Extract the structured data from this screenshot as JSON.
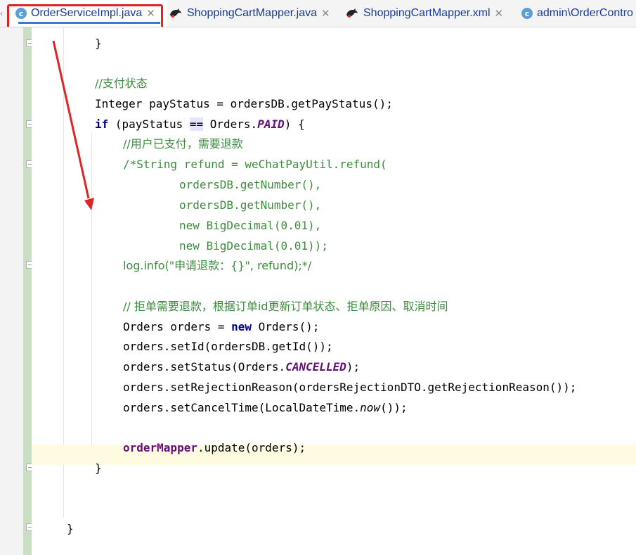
{
  "tabs": [
    {
      "label": "OrderServiceImpl.java",
      "icon": "java-class-icon",
      "active": true,
      "closable": true
    },
    {
      "label": "ShoppingCartMapper.java",
      "icon": "mybatis-mapper-icon",
      "active": false,
      "closable": true
    },
    {
      "label": "ShoppingCartMapper.xml",
      "icon": "mybatis-mapper-icon",
      "active": false,
      "closable": true
    },
    {
      "label": "admin\\OrderContro",
      "icon": "java-class-icon",
      "active": false,
      "closable": false
    }
  ],
  "tab_close_glyph": "✕",
  "class_icon_letter": "c",
  "colors": {
    "active_tab_outline": "#e02424",
    "annotation_arrow": "#e02424",
    "keyword": "#000080",
    "comment": "#3d8c3d",
    "constant": "#660e7a"
  },
  "code": {
    "l01": "}",
    "l03": "//支付状态",
    "l04_a": "Integer payStatus = ordersDB.getPayStatus();",
    "l05_kw": "if",
    "l05_a": " (payStatus ",
    "l05_op": "==",
    "l05_b": " Orders.",
    "l05_const": "PAID",
    "l05_c": ") {",
    "l06": "//用户已支付，需要退款",
    "l07": "/*String refund = weChatPayUtil.refund(",
    "l08": "ordersDB.getNumber(),",
    "l09": "ordersDB.getNumber(),",
    "l10": "new BigDecimal(0.01),",
    "l11": "new BigDecimal(0.01));",
    "l12": "log.info(\"申请退款：{}\", refund);*/",
    "l14": "// 拒单需要退款，根据订单id更新订单状态、拒单原因、取消时间",
    "l15_a": "Orders orders = ",
    "l15_kw": "new",
    "l15_b": " Orders();",
    "l16": "orders.setId(ordersDB.getId());",
    "l17_a": "orders.setStatus(Orders.",
    "l17_const": "CANCELLED",
    "l17_b": ");",
    "l18": "orders.setRejectionReason(ordersRejectionDTO.getRejectionReason());",
    "l19_a": "orders.setCancelTime(LocalDateTime.",
    "l19_it": "now",
    "l19_b": "());",
    "l21_field": "orderMapper",
    "l21_a": ".update(orders);",
    "l22": "}",
    "l25": "}"
  }
}
